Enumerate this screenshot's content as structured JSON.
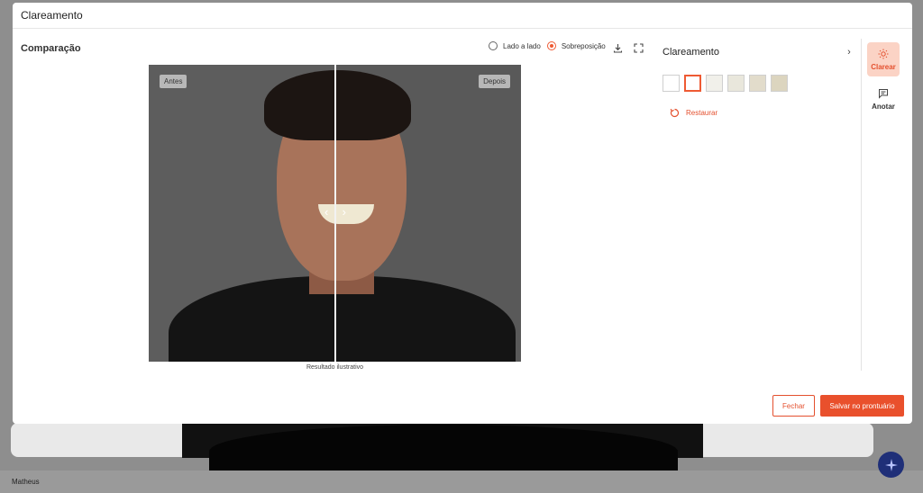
{
  "window": {
    "title": "Clareamento"
  },
  "comparison": {
    "title": "Comparação",
    "modes": [
      {
        "label": "Lado a lado",
        "selected": false
      },
      {
        "label": "Sobreposição",
        "selected": true
      }
    ],
    "before_label": "Antes",
    "after_label": "Depois",
    "caption": "Resultado ilustrativo"
  },
  "panel": {
    "title": "Clareamento",
    "shades": [
      "#ffffff",
      "#ffffff",
      "#f1f0ea",
      "#e9e7dc",
      "#e2dccb",
      "#dcd5bf"
    ],
    "selected_shade_index": 1,
    "restore_label": "Restaurar"
  },
  "sidebar": {
    "items": [
      {
        "label": "Clarear",
        "active": true
      },
      {
        "label": "Anotar",
        "active": false
      }
    ]
  },
  "footer": {
    "close_label": "Fechar",
    "save_label": "Salvar no prontuário"
  },
  "background": {
    "user_name": "Matheus"
  },
  "colors": {
    "accent": "#e9502c",
    "accent_soft": "#fbd3c5"
  }
}
